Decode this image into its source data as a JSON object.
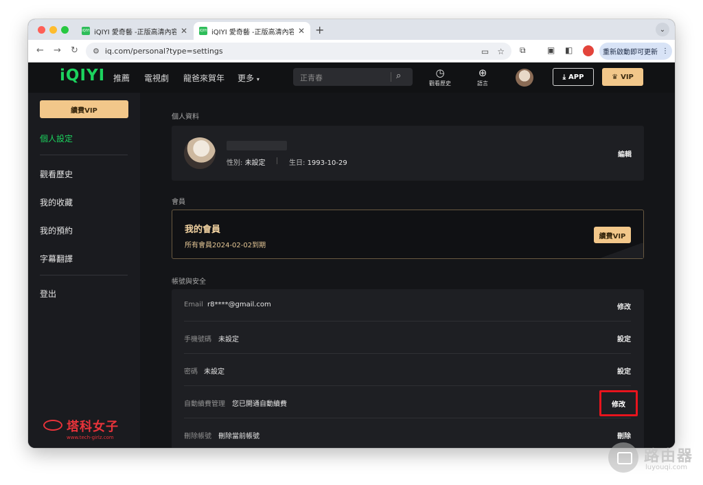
{
  "browser": {
    "tabs": [
      {
        "title": "iQIYI 愛奇藝 -正版高清內容免費",
        "active": false
      },
      {
        "title": "iQIYI 愛奇藝 -正版高清內容免費",
        "active": true
      }
    ],
    "new_tab_symbol": "+",
    "url": "iq.com/personal?type=settings",
    "update_button": "重新啟動即可更新",
    "favicon_text": "iQIYI"
  },
  "header": {
    "logo": "iQIYI",
    "nav": [
      "推薦",
      "電視劇",
      "龍爸來賀年",
      "更多"
    ],
    "search_placeholder": "正青春",
    "history_label": "觀看歷史",
    "language_label": "語言",
    "app_button": "APP",
    "vip_button": "VIP"
  },
  "sidebar": {
    "renew_vip": "續費VIP",
    "items": [
      {
        "label": "個人設定",
        "active": true
      },
      {
        "label": "觀看歷史"
      },
      {
        "label": "我的收藏"
      },
      {
        "label": "我的預約"
      },
      {
        "label": "字幕翻譯"
      },
      {
        "label": "登出"
      }
    ],
    "watermark_main": "塔科女子",
    "watermark_sub": "www.tech-girlz.com"
  },
  "profile": {
    "section_title": "個人資料",
    "gender_label": "性別:",
    "gender_value": "未設定",
    "birthday_label": "生日:",
    "birthday_value": "1993-10-29",
    "edit": "編輯"
  },
  "membership": {
    "section_title": "會員",
    "title": "我的會員",
    "subtitle": "所有會員2024-02-02到期",
    "renew": "續費VIP"
  },
  "account": {
    "section_title": "帳號與安全",
    "rows": [
      {
        "key": "Email",
        "value": "r8****@gmail.com",
        "action": "修改"
      },
      {
        "key": "手機號碼",
        "value": "未設定",
        "action": "設定"
      },
      {
        "key": "密碼",
        "value": "未設定",
        "action": "設定"
      },
      {
        "key": "自動續費管理",
        "value": "您已開通自動續費",
        "action": "修改",
        "highlighted": true
      },
      {
        "key": "刪除帳號",
        "value": "刪除當前帳號",
        "action": "刪除"
      }
    ]
  },
  "brand_overlay": {
    "name": "路由器",
    "site": "luyouqi.com"
  },
  "colors": {
    "accent_green": "#1cd35e",
    "vip_gold": "#f2c78a",
    "highlight_red": "#e8141d"
  }
}
